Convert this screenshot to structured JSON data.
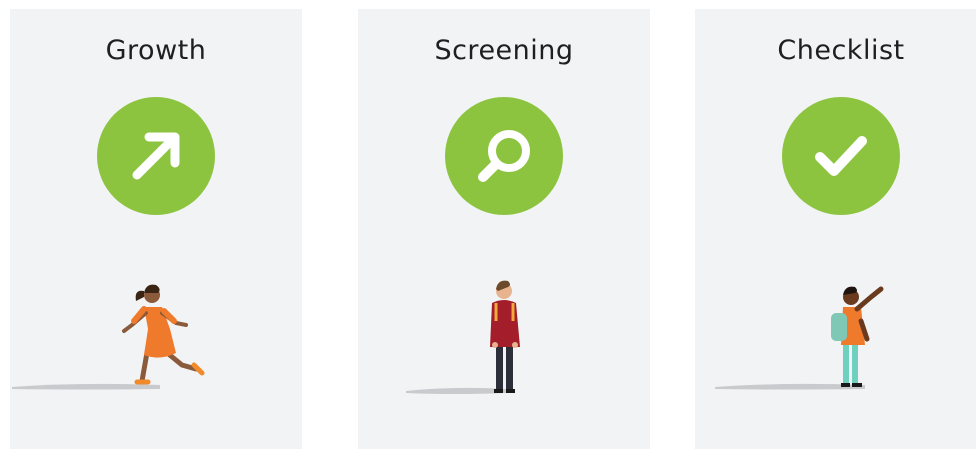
{
  "cards": [
    {
      "title": "Growth",
      "icon": "arrow-up-right-icon",
      "illustration": "girl-running"
    },
    {
      "title": "Screening",
      "icon": "magnifying-glass-icon",
      "illustration": "boy-standing"
    },
    {
      "title": "Checklist",
      "icon": "checkmark-icon",
      "illustration": "child-pointing"
    }
  ],
  "colors": {
    "card_background": "#f2f3f5",
    "icon_circle": "#8dc43f",
    "icon_glyph": "#ffffff",
    "title_text": "#1d1f22"
  }
}
